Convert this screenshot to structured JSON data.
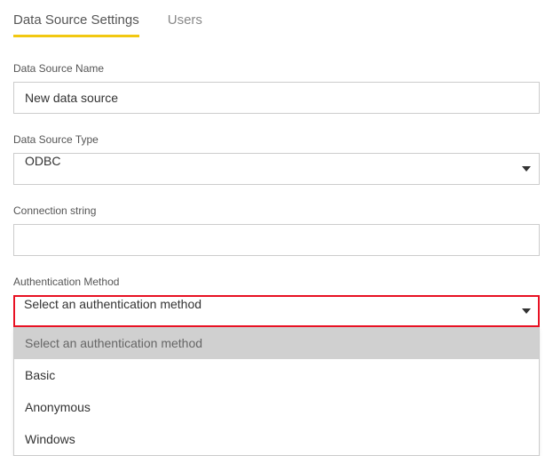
{
  "tabs": {
    "settings": "Data Source Settings",
    "users": "Users"
  },
  "fields": {
    "name": {
      "label": "Data Source Name",
      "value": "New data source"
    },
    "type": {
      "label": "Data Source Type",
      "value": "ODBC"
    },
    "connection": {
      "label": "Connection string",
      "value": ""
    },
    "auth": {
      "label": "Authentication Method",
      "value": "Select an authentication method",
      "options": {
        "placeholder": "Select an authentication method",
        "basic": "Basic",
        "anonymous": "Anonymous",
        "windows": "Windows"
      }
    }
  }
}
